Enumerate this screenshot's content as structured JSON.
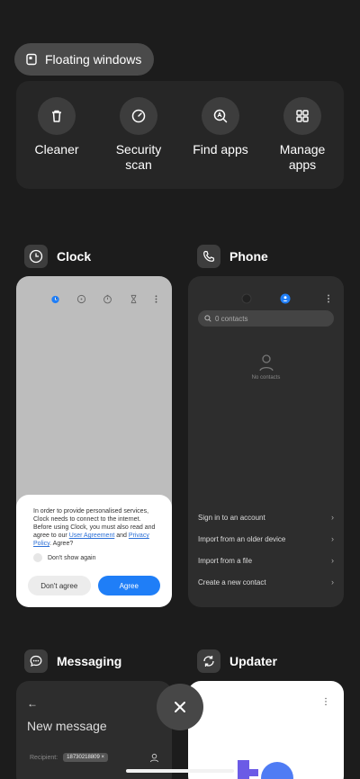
{
  "floating_windows_label": "Floating windows",
  "tools": [
    {
      "icon": "trash-icon",
      "label": "Cleaner"
    },
    {
      "icon": "security-scan-icon",
      "label": "Security scan"
    },
    {
      "icon": "find-apps-icon",
      "label": "Find apps"
    },
    {
      "icon": "grid-icon",
      "label": "Manage apps"
    }
  ],
  "apps": {
    "clock": {
      "name": "Clock",
      "dialog": {
        "message_part1": "In order to provide personalised services, Clock needs to connect to the internet. Before using Clock, you must also read and agree to our ",
        "link1": "User Agreement",
        "and": " and ",
        "link2": "Privacy Policy",
        "message_end": ". Agree?",
        "dont_show_again": "Don't show again",
        "disagree_label": "Don't agree",
        "agree_label": "Agree"
      }
    },
    "phone": {
      "name": "Phone",
      "search_placeholder": "0 contacts",
      "empty_text": "No contacts",
      "menu": [
        "Sign in to an account",
        "Import from an older device",
        "Import from a file",
        "Create a new contact"
      ]
    },
    "messaging": {
      "name": "Messaging",
      "back_glyph": "←",
      "title": "New message",
      "recipient_label": "Recipient:",
      "recipient_value": "18730218809"
    },
    "updater": {
      "name": "Updater"
    }
  },
  "colors": {
    "background": "#1c1c1c",
    "accent_blue": "#1f7ef7"
  }
}
